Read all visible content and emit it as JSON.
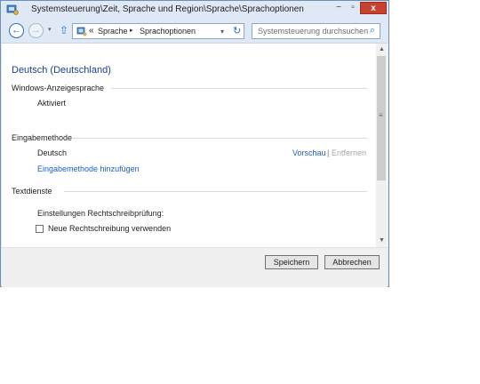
{
  "window": {
    "title": "Systemsteuerung\\Zeit, Sprache und Region\\Sprache\\Sprachoptionen",
    "icons": {
      "app": "control-panel-icon",
      "minimize": "minimize-icon",
      "maximize": "maximize-icon",
      "close": "close-icon"
    },
    "buttons": {
      "minimize": "−",
      "maximize": "▫",
      "close": "x"
    }
  },
  "navbar": {
    "back_glyph": "←",
    "forward_glyph": "→",
    "history_glyph": "▾",
    "up_glyph": "⇧",
    "address": {
      "overflow_glyph": "«",
      "crumbs": [
        "Sprache",
        "Sprachoptionen"
      ],
      "separator_glyph": "▸",
      "dropdown_glyph": "▾",
      "refresh_glyph": "↻"
    },
    "search": {
      "placeholder": "Systemsteuerung durchsuchen",
      "icon_glyph": "⌕"
    }
  },
  "content": {
    "heading": "Deutsch (Deutschland)",
    "display_language": {
      "title": "Windows-Anzeigesprache",
      "status": "Aktiviert"
    },
    "input_method": {
      "title": "Eingabemethode",
      "method": "Deutsch",
      "preview_link": "Vorschau",
      "separator": "|",
      "remove_link": "Entfernen",
      "add_link": "Eingabemethode hinzufügen"
    },
    "text_services": {
      "title": "Textdienste",
      "spellcheck_label": "Einstellungen Rechtschreibprüfung:",
      "new_spelling_label": "Neue Rechtschreibung verwenden",
      "new_spelling_checked": false
    }
  },
  "scrollbar": {
    "up_glyph": "▲",
    "grip_glyph": "≡",
    "down_glyph": "▼"
  },
  "footer": {
    "save": "Speichern",
    "cancel": "Abbrechen"
  },
  "colors": {
    "heading": "#1e3f8a",
    "link": "#1a5ec3",
    "disabled": "#a6a6a6",
    "close_button": "#c8412f",
    "window_frame": "#dfe9f5"
  }
}
